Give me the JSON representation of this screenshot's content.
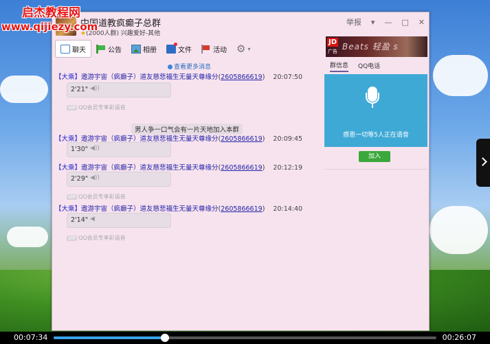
{
  "watermark": {
    "title": "启杰教程网",
    "url": "www.qijiezy.com"
  },
  "window": {
    "group_name": "中国道教疯癫子总群",
    "group_sub": "(2000人群) 兴趣爱好-其他",
    "controls": {
      "report": "举报",
      "menu": "▾",
      "minimize": "—",
      "restore": "□",
      "close": "✕"
    }
  },
  "toolbar": {
    "items": [
      {
        "label": "聊天",
        "icon": "chat-icon"
      },
      {
        "label": "公告",
        "icon": "notice-flag-icon"
      },
      {
        "label": "相册",
        "icon": "photo-icon"
      },
      {
        "label": "文件",
        "icon": "file-icon"
      },
      {
        "label": "活动",
        "icon": "event-flag-icon"
      }
    ],
    "settings_icon": "gear-icon"
  },
  "banner": {
    "brand": "JD",
    "ad_label": "广告",
    "text": "Beats 轻盈 s"
  },
  "chat": {
    "more_history": "查看更多消息",
    "messages": [
      {
        "tag": "【大乘】",
        "sender": "遨游宇宙（疯癫子）道友慈悲福生无量天尊缘分",
        "qq": "2605866619",
        "time": "20:07:50",
        "duration": "2'21\"",
        "wave": "◀))"
      },
      {
        "tag": "【大乘】",
        "sender": "遨游宇宙（疯癫子）道友慈悲福生无量天尊缘分",
        "qq": "2605866619",
        "time": "20:09:45",
        "duration": "1'30\"",
        "wave": "◀))"
      },
      {
        "tag": "【大乘】",
        "sender": "遨游宇宙（疯癫子）道友慈悲福生无量天尊缘分",
        "qq": "2605866619",
        "time": "20:12:19",
        "duration": "2'29\"",
        "wave": "◀))"
      },
      {
        "tag": "【大乘】",
        "sender": "遨游宇宙（疯癫子）道友慈悲福生无量天尊缘分",
        "qq": "2605866619",
        "time": "20:14:40",
        "duration": "2'14\"",
        "wave": "◀"
      }
    ],
    "vip_badge": "VIP",
    "vip_note": "QQ会员专享彩语音",
    "system_notice": "男人争一口气会有一片天地加入本群"
  },
  "right_panel": {
    "tabs": [
      "群信息",
      "QQ电话"
    ],
    "voice_status": "感恩一切等5人正在语音",
    "join_label": "加入",
    "mic_icon": "microphone-icon"
  },
  "player": {
    "current": "00:07:34",
    "total": "00:26:07",
    "progress": 0.29
  }
}
